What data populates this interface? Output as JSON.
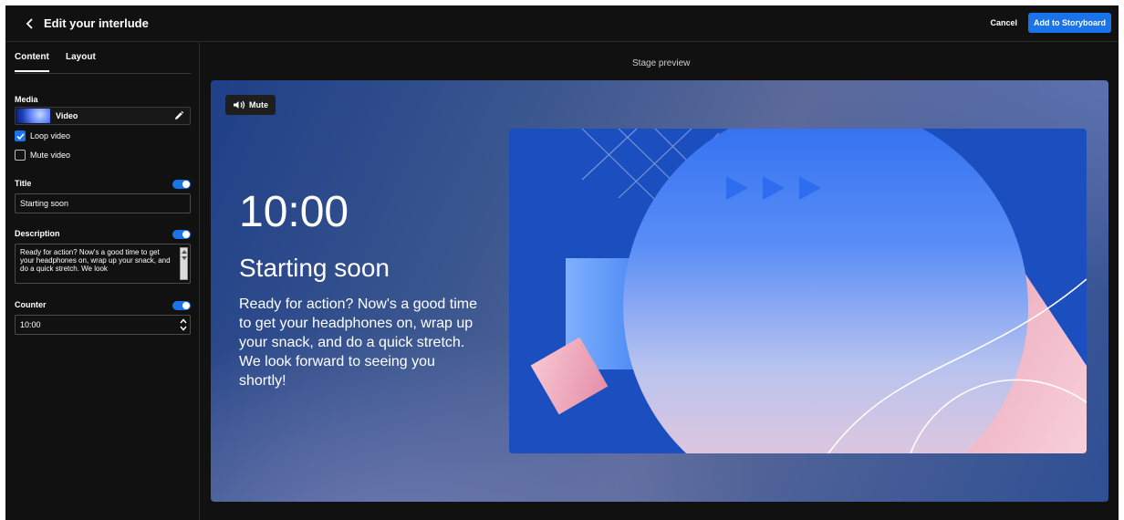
{
  "header": {
    "title": "Edit your interlude",
    "cancel_label": "Cancel",
    "add_label": "Add to Storyboard"
  },
  "sidebar": {
    "tabs": [
      "Content",
      "Layout"
    ],
    "active_tab": "Content",
    "media": {
      "label": "Media",
      "value": "Video",
      "loop_label": "Loop video",
      "loop_checked": true,
      "mute_label": "Mute video",
      "mute_checked": false
    },
    "title": {
      "label": "Title",
      "enabled": true,
      "value": "Starting soon"
    },
    "description": {
      "label": "Description",
      "enabled": true,
      "value": "Ready for action? Now's a good time to get your headphones on, wrap up your snack, and do a quick stretch. We look"
    },
    "counter": {
      "label": "Counter",
      "enabled": true,
      "value": "10:00"
    }
  },
  "stage": {
    "label": "Stage preview",
    "mute_label": "Mute",
    "counter": "10:00",
    "title": "Starting soon",
    "description": "Ready for action? Now's a good time to get your headphones on, wrap up your snack, and do a quick stretch. We look forward to seeing you shortly!"
  },
  "colors": {
    "accent": "#1a73e8",
    "background": "#111111",
    "art_blue": "#1e56c6",
    "art_pink": "#f2b8c6"
  },
  "icons": {
    "back": "chevron-left-icon",
    "edit": "pencil-icon",
    "check": "checkmark-icon",
    "mute": "speaker-icon"
  }
}
